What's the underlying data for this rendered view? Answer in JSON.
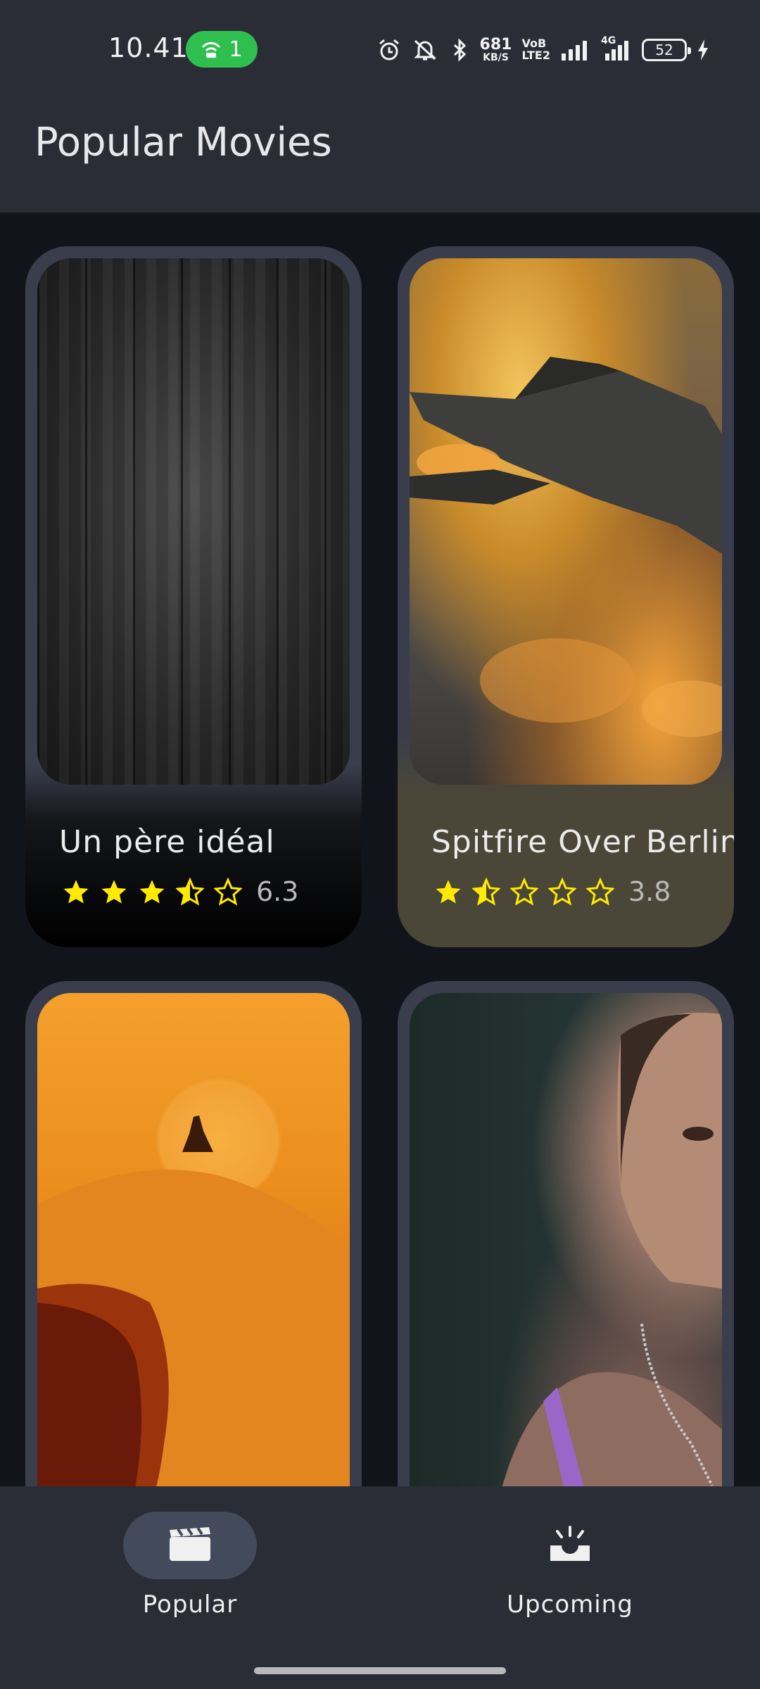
{
  "status_bar": {
    "time": "10.41",
    "hotspot_count": "1",
    "net_speed_value": "681",
    "net_speed_unit": "KB/S",
    "vo_label": "VoB",
    "lte_label": "LTE2",
    "network_4g": "4G",
    "battery_level": "52",
    "icons": [
      "hotspot-icon",
      "alarm-icon",
      "mute-icon",
      "bluetooth-icon",
      "signal-icon",
      "signal-4g-icon",
      "battery-icon",
      "charging-icon"
    ]
  },
  "app_bar": {
    "title": "Popular Movies"
  },
  "movies": [
    {
      "title": "Un père idéal",
      "score": "6.3",
      "stars": [
        1,
        1,
        1,
        0.5,
        0
      ],
      "poster": "dark-wood-texture",
      "card_color": "#000000"
    },
    {
      "title": "Spitfire Over Berlin",
      "score": "3.8",
      "stars": [
        1,
        0.5,
        0,
        0,
        0
      ],
      "poster": "fighter-plane-over-city",
      "card_color": "#4a4638"
    },
    {
      "title": "",
      "score": "",
      "stars": [],
      "poster": "desert-dunes",
      "card_color": "#3a3e4c"
    },
    {
      "title": "",
      "score": "",
      "stars": [],
      "poster": "portrait-woman",
      "card_color": "#3a3e4c"
    }
  ],
  "bottom_nav": {
    "items": [
      {
        "label": "Popular",
        "icon": "clapperboard-icon",
        "active": true
      },
      {
        "label": "Upcoming",
        "icon": "upcoming-icon",
        "active": false
      }
    ]
  },
  "colors": {
    "background": "#11141b",
    "bars": "#2a2d36",
    "star": "#ffea00",
    "active_pill": "#434a5c",
    "hotspot": "#2fbf4f"
  }
}
